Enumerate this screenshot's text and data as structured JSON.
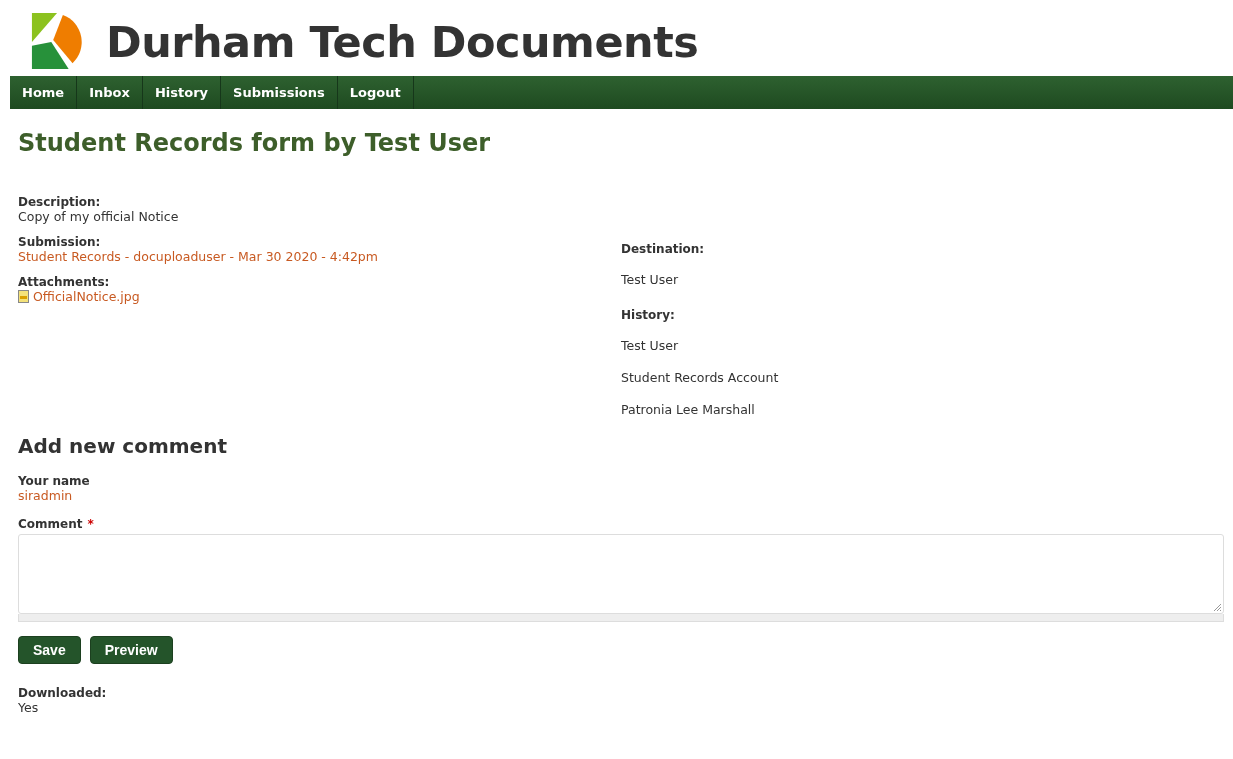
{
  "site": {
    "title": "Durham Tech Documents"
  },
  "nav": [
    {
      "label": "Home"
    },
    {
      "label": "Inbox"
    },
    {
      "label": "History"
    },
    {
      "label": "Submissions"
    },
    {
      "label": "Logout"
    }
  ],
  "page_title": "Student Records form by Test User",
  "left": {
    "description_label": "Description:",
    "description": "Copy of my official Notice",
    "submission_label": "Submission:",
    "submission": "Student Records - docuploaduser - Mar 30 2020 - 4:42pm",
    "attachments_label": "Attachments:",
    "attachments": [
      "OfficialNotice.jpg"
    ]
  },
  "right": {
    "destination_label": "Destination:",
    "destination": [
      "Test User"
    ],
    "history_label": "History:",
    "history": [
      "Test User",
      "Student Records Account",
      "Patronia Lee Marshall"
    ]
  },
  "comment_form": {
    "heading": "Add new comment",
    "name_label": "Your name",
    "name": "siradmin",
    "comment_label": "Comment",
    "required_mark": "*",
    "buttons": [
      "Save",
      "Preview"
    ]
  },
  "downloaded": {
    "label": "Downloaded:",
    "value": "Yes"
  }
}
